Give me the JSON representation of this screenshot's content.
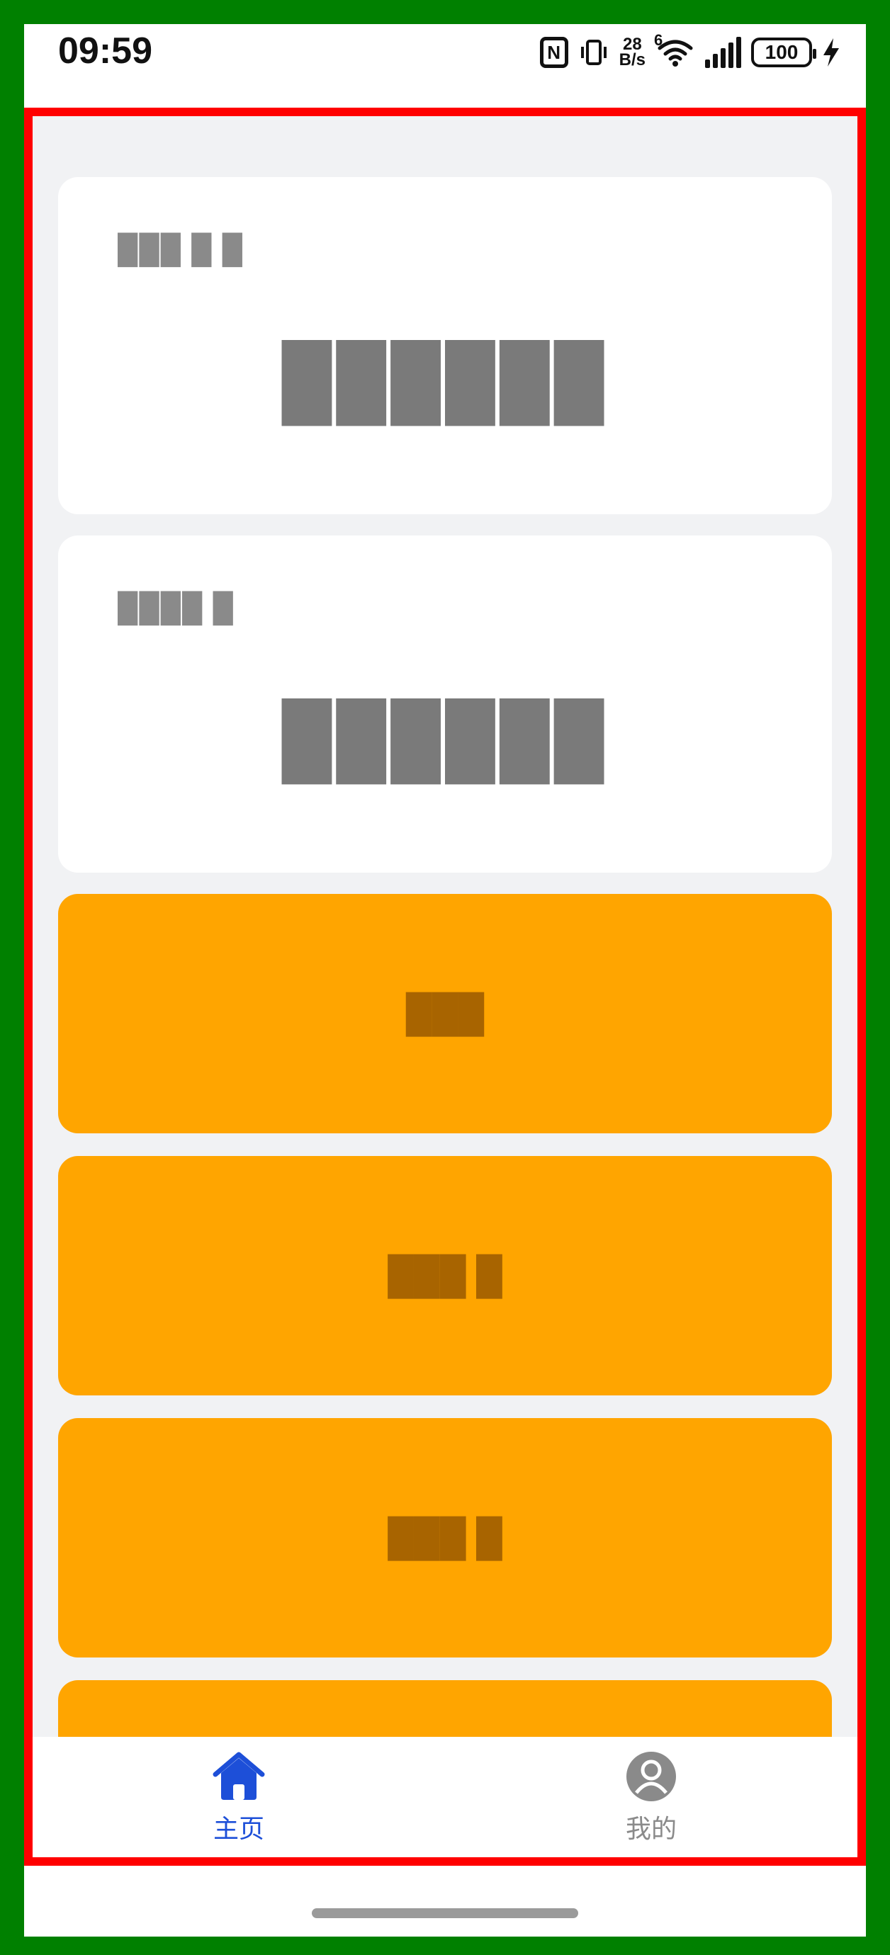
{
  "status_bar": {
    "time": "09:59",
    "nfc": "N",
    "speed_value": "28",
    "speed_unit": "B/s",
    "wifi_sup": "6",
    "battery": "100"
  },
  "cards": [
    {
      "label": "███ █ █",
      "value": "██████"
    },
    {
      "label": "████ █",
      "value": "██████"
    }
  ],
  "actions": [
    {
      "label": "███"
    },
    {
      "label": "███ █"
    },
    {
      "label": "███ █"
    },
    {
      "label": ""
    }
  ],
  "tabs": [
    {
      "label": "主页",
      "icon": "home-icon",
      "active": true
    },
    {
      "label": "我的",
      "icon": "user-icon",
      "active": false
    }
  ],
  "colors": {
    "accent": "#1d4fd8",
    "action": "#ffa500",
    "background": "#f1f2f4",
    "frame": "#ff0000"
  }
}
